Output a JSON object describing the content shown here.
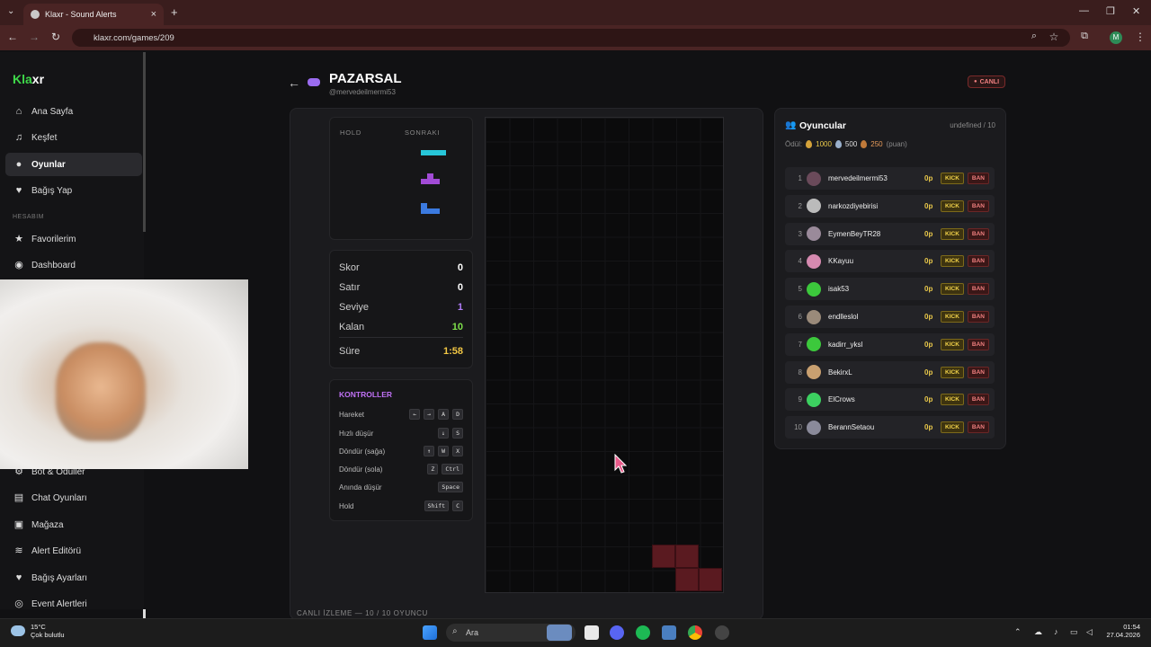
{
  "browser": {
    "tab_title": "Klaxr - Sound Alerts",
    "url": "klaxr.com/games/209",
    "profile_initial": "M"
  },
  "sidebar": {
    "logo": "Klaxr",
    "section": "HESABIM",
    "items": [
      {
        "label": "Ana Sayfa",
        "icon": "home-icon"
      },
      {
        "label": "Keşfet",
        "icon": "music-note-icon"
      },
      {
        "label": "Oyunlar",
        "icon": "gamepad-icon"
      },
      {
        "label": "Bağış Yap",
        "icon": "heart-icon"
      },
      {
        "label": "Favorilerim",
        "icon": "star-icon"
      },
      {
        "label": "Dashboard",
        "icon": "palette-icon"
      },
      {
        "label": "Bot & Ödüller",
        "icon": "bot-icon"
      },
      {
        "label": "Chat Oyunları",
        "icon": "chat-icon"
      },
      {
        "label": "Mağaza",
        "icon": "store-icon"
      },
      {
        "label": "Alert Editörü",
        "icon": "layers-icon"
      },
      {
        "label": "Bağış Ayarları",
        "icon": "heart-icon"
      },
      {
        "label": "Event Alertleri",
        "icon": "target-icon"
      }
    ]
  },
  "game": {
    "title": "PAZARSAL",
    "subtitle": "@mervedeilmermi53",
    "live": "CANLI",
    "hold_label": "HOLD",
    "next_label": "SONRAKI",
    "stats": [
      {
        "label": "Skor",
        "value": "0",
        "color": "#ffffff"
      },
      {
        "label": "Satır",
        "value": "0",
        "color": "#ffffff"
      },
      {
        "label": "Seviye",
        "value": "1",
        "color": "#b07cf7"
      },
      {
        "label": "Kalan",
        "value": "10",
        "color": "#7ee04a"
      },
      {
        "label": "Süre",
        "value": "1:58",
        "color": "#f2c744"
      }
    ],
    "controls_title": "KONTROLLER",
    "controls": [
      {
        "label": "Hareket",
        "keys": [
          "←",
          "→",
          "A",
          "D"
        ]
      },
      {
        "label": "Hızlı düşür",
        "keys": [
          "↓",
          "S"
        ]
      },
      {
        "label": "Döndür (sağa)",
        "keys": [
          "↑",
          "W",
          "X"
        ]
      },
      {
        "label": "Döndür (sola)",
        "keys": [
          "Z",
          "Ctrl"
        ]
      },
      {
        "label": "Anında düşür",
        "keys": [
          "Space"
        ]
      },
      {
        "label": "Hold",
        "keys": [
          "Shift",
          "C"
        ]
      }
    ],
    "footer": "CANLI İZLEME — 10 / 10 OYUNCU"
  },
  "players": {
    "title": "Oyuncular",
    "count": "undefined / 10",
    "prize_label": "Ödül:",
    "prizes": [
      "1000",
      "500",
      "250"
    ],
    "prize_unit": "(puan)",
    "kick": "KICK",
    "ban": "BAN",
    "list": [
      {
        "rank": "1",
        "name": "mervedeilmermi53",
        "points": "0p",
        "avatar": "#6a4a5a"
      },
      {
        "rank": "2",
        "name": "narkozdiyebirisi",
        "points": "0p",
        "avatar": "#bbbbbb"
      },
      {
        "rank": "3",
        "name": "EymenBeyTR28",
        "points": "0p",
        "avatar": "#9a8a9a"
      },
      {
        "rank": "4",
        "name": "KKayuu",
        "points": "0p",
        "avatar": "#d68ab0"
      },
      {
        "rank": "5",
        "name": "isak53",
        "points": "0p",
        "avatar": "#3cc83c"
      },
      {
        "rank": "6",
        "name": "endlleslol",
        "points": "0p",
        "avatar": "#9a8a7a"
      },
      {
        "rank": "7",
        "name": "kadirr_yksl",
        "points": "0p",
        "avatar": "#3cc83c"
      },
      {
        "rank": "8",
        "name": "BekirxL",
        "points": "0p",
        "avatar": "#c9a070"
      },
      {
        "rank": "9",
        "name": "ElCrows",
        "points": "0p",
        "avatar": "#3cd060"
      },
      {
        "rank": "10",
        "name": "BerannSetaou",
        "points": "0p",
        "avatar": "#8a8a9a"
      }
    ]
  },
  "taskbar": {
    "temp": "15°C",
    "weather": "Çok bulutlu",
    "search": "Ara",
    "time": "01:54",
    "date": "27.04.2026"
  }
}
